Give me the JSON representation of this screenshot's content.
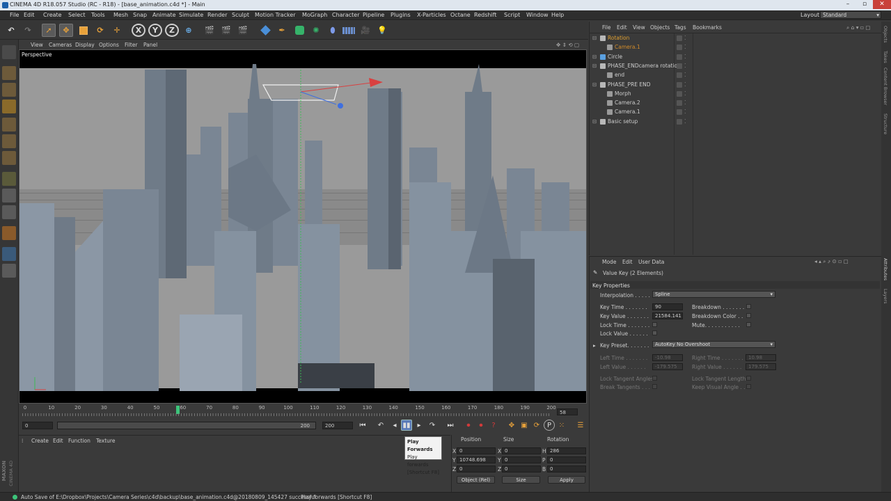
{
  "window": {
    "title": "CINEMA 4D R18.057 Studio (RC - R18) - [base_animation.c4d *] - Main",
    "controls": [
      "–",
      "▫",
      "✕"
    ]
  },
  "menubar": {
    "items": [
      "File",
      "Edit",
      "Create",
      "Select",
      "Tools",
      "Mesh",
      "Snap",
      "Animate",
      "Simulate",
      "Render",
      "Sculpt",
      "Motion Tracker",
      "MoGraph",
      "Character",
      "Pipeline",
      "Plugins",
      "X-Particles",
      "Octane",
      "Redshift",
      "Script",
      "Window",
      "Help"
    ],
    "layout_label": "Layout:",
    "layout_value": "Standard"
  },
  "toolbar": {
    "axis_x": "X",
    "axis_y": "Y",
    "axis_z": "Z",
    "icons": [
      "undo-icon",
      "redo-icon",
      "select-icon",
      "move-icon",
      "scale-icon",
      "rotate-icon",
      "live-select-icon",
      "x-axis-icon",
      "y-axis-icon",
      "z-axis-icon",
      "world-coord-icon",
      "render-view-icon",
      "render-picture-viewer-icon",
      "render-settings-icon",
      "cube-icon",
      "pen-icon",
      "subdivision-icon",
      "cloner-icon",
      "deformer-icon",
      "floor-icon",
      "camera-icon",
      "light-icon"
    ]
  },
  "viewport": {
    "menu": [
      "View",
      "Cameras",
      "Display",
      "Options",
      "Filter",
      "Panel"
    ],
    "label": "Perspective"
  },
  "timeline": {
    "ticks": [
      "0",
      "10",
      "20",
      "30",
      "40",
      "50",
      "60",
      "70",
      "80",
      "90",
      "100",
      "110",
      "120",
      "130",
      "140",
      "150",
      "160",
      "170",
      "180",
      "190",
      "200"
    ],
    "current_frame": 58,
    "current_frame_label": "58",
    "start_field": "0",
    "end_field": "200",
    "range_end_label": "200",
    "range_start_label": "0"
  },
  "tooltip": {
    "title": "Play Forwards",
    "line1": "Play forwards",
    "line2": "[Shortcut F8]"
  },
  "material_manager": {
    "menu": [
      "Create",
      "Edit",
      "Function",
      "Texture"
    ],
    "brand_top": "MAXON",
    "brand_bottom": "CINEMA 4D"
  },
  "coordinates": {
    "headers": [
      "Position",
      "Size",
      "Rotation"
    ],
    "rows": [
      {
        "axis": "X",
        "pos": "0",
        "size_axis": "X",
        "size": "0",
        "rot_axis": "H",
        "rot": "286"
      },
      {
        "axis": "Y",
        "pos": "10748.698",
        "size_axis": "Y",
        "size": "0",
        "rot_axis": "P",
        "rot": "0"
      },
      {
        "axis": "Z",
        "pos": "0",
        "size_axis": "Z",
        "size": "0",
        "rot_axis": "B",
        "rot": "0"
      }
    ],
    "mode_dropdown": "Object (Rel)",
    "size_dropdown": "Size",
    "apply_label": "Apply"
  },
  "object_manager": {
    "menu": [
      "File",
      "Edit",
      "View",
      "Objects",
      "Tags",
      "Bookmarks"
    ],
    "objects": [
      {
        "name": "Rotation",
        "indent": 0,
        "color": "#e0a030",
        "icon_color": "#b8b8b8",
        "highlight": true
      },
      {
        "name": "Camera.1",
        "indent": 1,
        "color": "#d08a2a",
        "icon_color": "#9a9a9a",
        "highlight": false
      },
      {
        "name": "Circle",
        "indent": 0,
        "color": "#cccccc",
        "icon_color": "#5aa0e0",
        "highlight": false
      },
      {
        "name": "PHASE_ENDcamera rotation",
        "indent": 0,
        "color": "#cccccc",
        "icon_color": "#b8b8b8",
        "highlight": false
      },
      {
        "name": "end",
        "indent": 1,
        "color": "#cccccc",
        "icon_color": "#9a9a9a",
        "highlight": false
      },
      {
        "name": "PHASE_PRE END",
        "indent": 0,
        "color": "#cccccc",
        "icon_color": "#b8b8b8",
        "highlight": false
      },
      {
        "name": "Morph",
        "indent": 1,
        "color": "#cccccc",
        "icon_color": "#9a9a9a",
        "highlight": false
      },
      {
        "name": "Camera.2",
        "indent": 1,
        "color": "#cccccc",
        "icon_color": "#9a9a9a",
        "highlight": false
      },
      {
        "name": "Camera.1",
        "indent": 1,
        "color": "#cccccc",
        "icon_color": "#9a9a9a",
        "highlight": false
      },
      {
        "name": "Basic setup",
        "indent": 0,
        "color": "#cccccc",
        "icon_color": "#b8b8b8",
        "highlight": false
      }
    ]
  },
  "attribute_manager": {
    "menu": [
      "Mode",
      "Edit",
      "User Data"
    ],
    "title": "Value Key (2 Elements)",
    "section": "Key Properties",
    "interpolation_label": "Interpolation . . . . .",
    "interpolation_value": "Spline",
    "key_time_label": "Key Time . . . . . . .",
    "key_time_value": "90",
    "key_value_label": "Key Value . . . . . . .",
    "key_value_value": "21584.141",
    "lock_time_label": "Lock Time . . . . . . .",
    "lock_value_label": "Lock Value . . . . . .",
    "breakdown_label": "Breakdown . . . . . . .",
    "breakdown_color_label": "Breakdown Color . .",
    "mute_label": "Mute. . . . . . . . . . .",
    "key_preset_label": "Key Preset. . . . . . .",
    "key_preset_value": "AutoKey No Overshoot",
    "left_time_label": "Left  Time . . . . . . .",
    "left_time_value": "-10.98",
    "left_value_label": "Left  Value . . . . . .",
    "left_value_value": "-179.575",
    "right_time_label": "Right Time . . . . . . .",
    "right_time_value": "10.98",
    "right_value_label": "Right Value . . . . . .",
    "right_value_value": "179.575",
    "lock_tangent_angles_label": "Lock Tangent Angles",
    "lock_tangent_lengths_label": "Lock Tangent Lengths",
    "break_tangents_label": "Break Tangents . . . .",
    "keep_visual_angle_label": "Keep Visual Angle . . ."
  },
  "side_tabs": [
    "Objects",
    "Takes",
    "Content Browser",
    "Structure",
    "Attributes",
    "Layers"
  ],
  "statusbar": {
    "autosave": "Auto Save of E:\\Dropbox\\Projects\\Camera Series\\c4d\\backup\\base_animation.c4d@20180809_145427 successful",
    "hint": "Play forwards [Shortcut F8]"
  },
  "colors": {
    "accent_orange": "#e0a030",
    "record_red": "#d23a3a",
    "playhead_green": "#3cc47a",
    "axis_x": "#d94040",
    "axis_y": "#3cba54",
    "axis_z": "#3f6fe0"
  }
}
